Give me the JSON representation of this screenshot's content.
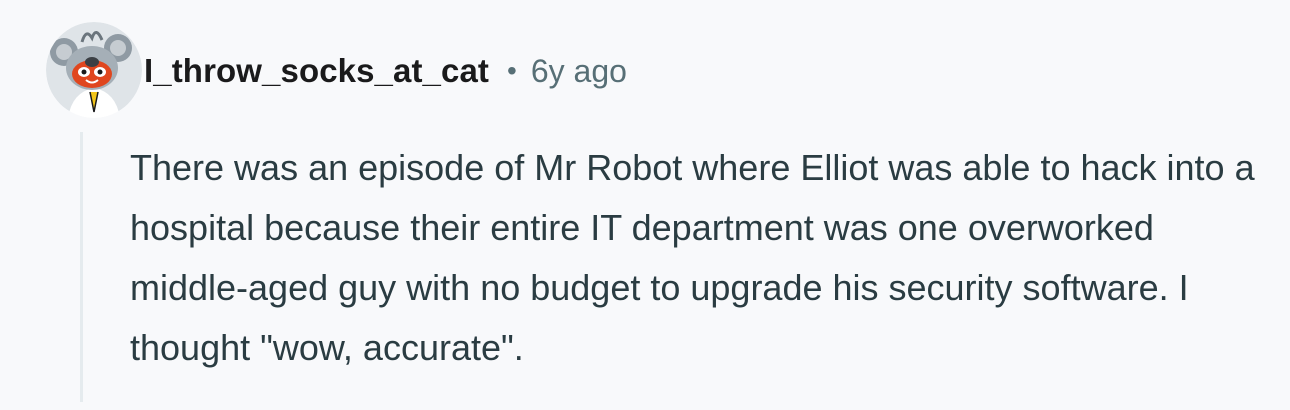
{
  "comment": {
    "author": "I_throw_socks_at_cat",
    "separator": "•",
    "age": "6y ago",
    "avatar_icon": "snoo-avatar-icon",
    "body": "There was an episode of Mr Robot where Elliot was able to hack into a hospital because their entire IT department was one overworked middle-aged guy with no budget to upgrade his security software. I thought \"wow, accurate\".",
    "colors": {
      "background": "#f8f9fb",
      "author": "#1a1a1b",
      "meta": "#576f76",
      "body": "#2a3c42",
      "thread_line": "#e5ebee"
    }
  }
}
